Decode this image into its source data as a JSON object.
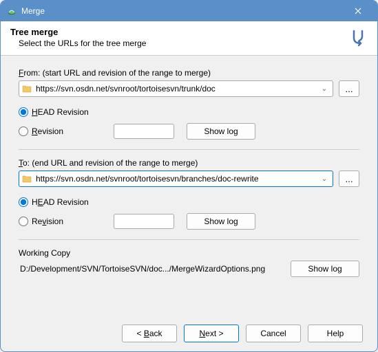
{
  "window": {
    "title": "Merge"
  },
  "header": {
    "title": "Tree merge",
    "subtitle": "Select the URLs for the tree merge"
  },
  "from": {
    "label": "From: (start URL and revision of the range to merge)",
    "url": "https://svn.osdn.net/svnroot/tortoisesvn/trunk/doc",
    "browse": "...",
    "head_label": "HEAD Revision",
    "rev_label": "Revision",
    "rev_value": "",
    "showlog": "Show log"
  },
  "to": {
    "label": "To: (end URL and revision of the range to merge)",
    "url": "https://svn.osdn.net/svnroot/tortoisesvn/branches/doc-rewrite",
    "browse": "...",
    "head_label": "HEAD Revision",
    "rev_label": "Revision",
    "rev_value": "",
    "showlog": "Show log"
  },
  "wc": {
    "label": "Working Copy",
    "path": "D:/Development/SVN/TortoiseSVN/doc.../MergeWizardOptions.png",
    "showlog": "Show log"
  },
  "buttons": {
    "back": "< Back",
    "next": "Next >",
    "cancel": "Cancel",
    "help": "Help"
  }
}
